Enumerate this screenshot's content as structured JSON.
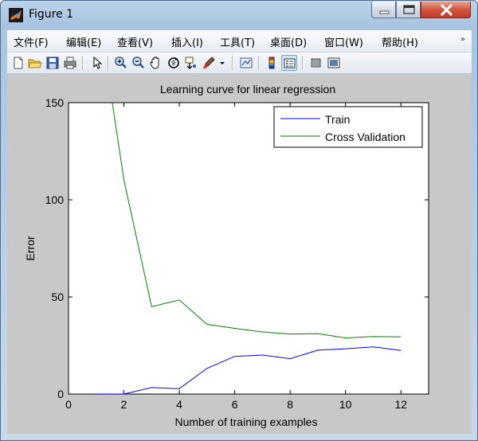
{
  "window": {
    "title": "Figure 1",
    "icon": "matlab-icon",
    "controls": [
      "minimize-icon",
      "maximize-icon",
      "close-icon"
    ]
  },
  "menu": [
    "文件(F)",
    "编辑(E)",
    "查看(V)",
    "插入(I)",
    "工具(T)",
    "桌面(D)",
    "窗口(W)",
    "帮助(H)"
  ],
  "menu_overflow": "»",
  "toolbar": [
    "new-figure-icon",
    "open-icon",
    "save-icon",
    "print-icon",
    "pointer-icon",
    "zoom-in-icon",
    "zoom-out-icon",
    "pan-icon",
    "rotate-3d-icon",
    "data-cursor-icon",
    "brush-icon",
    "dropdown-arrow-icon",
    "link-plot-icon",
    "colorbar-icon",
    "legend-icon",
    "hide-plot-tools-icon",
    "show-plot-tools-icon"
  ],
  "colors": {
    "train": "#0000ff",
    "cv": "#008000",
    "figure_bg": "#c8c8c8",
    "axes_bg": "#ffffff"
  },
  "chart_data": {
    "type": "line",
    "title": "Learning curve for linear regression",
    "xlabel": "Number of training examples",
    "ylabel": "Error",
    "xlim": [
      0,
      13
    ],
    "ylim": [
      0,
      150
    ],
    "xticks": [
      0,
      2,
      4,
      6,
      8,
      10,
      12
    ],
    "yticks": [
      0,
      50,
      100,
      150
    ],
    "grid": false,
    "legend_position": "top-right",
    "series": [
      {
        "name": "Train",
        "color": "#0000ff",
        "x": [
          1,
          2,
          3,
          4,
          5,
          6,
          7,
          8,
          9,
          10,
          11,
          12
        ],
        "y": [
          0.0,
          0.0,
          3.3,
          2.8,
          13.2,
          19.4,
          20.1,
          18.2,
          22.6,
          23.3,
          24.3,
          22.4
        ]
      },
      {
        "name": "Cross Validation",
        "color": "#008000",
        "x": [
          1,
          2,
          3,
          4,
          5,
          6,
          7,
          8,
          9,
          10,
          11,
          12
        ],
        "y": [
          205.1,
          110.3,
          45.0,
          48.4,
          35.9,
          33.8,
          31.97,
          30.9,
          31.1,
          28.9,
          29.6,
          29.4
        ]
      }
    ]
  }
}
